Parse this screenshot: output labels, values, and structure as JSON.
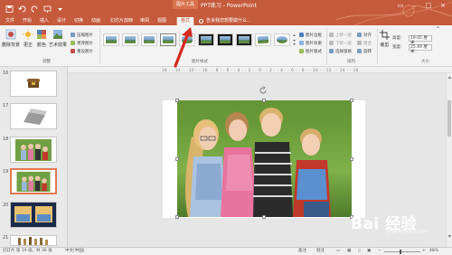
{
  "window": {
    "title": "PPT练习 - PowerPoint",
    "context_group": "图片工具"
  },
  "tabs": [
    "文件",
    "开始",
    "插入",
    "设计",
    "切换",
    "动画",
    "幻灯片放映",
    "审阅",
    "视图",
    "格式"
  ],
  "tell_me": "告诉我您想要做什么...",
  "ribbon": {
    "adjust": {
      "remove_bg": "删除背景",
      "corrections": "更正",
      "color": "颜色",
      "artistic": "艺术效果",
      "compress": "压缩图片",
      "change": "更改图片",
      "reset": "重设图片",
      "label": "调整"
    },
    "styles": {
      "label": "图片样式",
      "border": "图片边框",
      "effects": "图片效果",
      "layout": "图片版式"
    },
    "arrange": {
      "label": "排列",
      "forward": "上移一层",
      "backward": "下移一层",
      "selection_pane": "选择窗格",
      "align": "对齐",
      "group": "组合",
      "rotate": "旋转"
    },
    "size": {
      "label": "大小",
      "crop": "裁剪",
      "height_label": "高度:",
      "height_value": "19.05 厘米",
      "width_label": "宽度:",
      "width_value": "25.49 厘米"
    }
  },
  "ruler_text": "16 · · 14 · · 12 · · 10 · · 8 · · 6 · · 4 · · 2 · · 0 · · 2 · · 4 · · 6 · · 8 · · 10 · · 12 · · 14 · · 16",
  "slides": [
    {
      "num": "16"
    },
    {
      "num": "17"
    },
    {
      "num": "18"
    },
    {
      "num": "19"
    },
    {
      "num": "20"
    },
    {
      "num": "21"
    }
  ],
  "status": {
    "slide_info": "幻灯片 第 19 张，共 30 张",
    "language": "中文(中国)",
    "notes": "备注",
    "comments": "批注",
    "zoom": "48%"
  },
  "watermark": {
    "text": "Bai 经验",
    "sub": "jingyan.baidu.com"
  },
  "colors": {
    "accent": "#c55a3c",
    "arrow": "#d42a20"
  }
}
